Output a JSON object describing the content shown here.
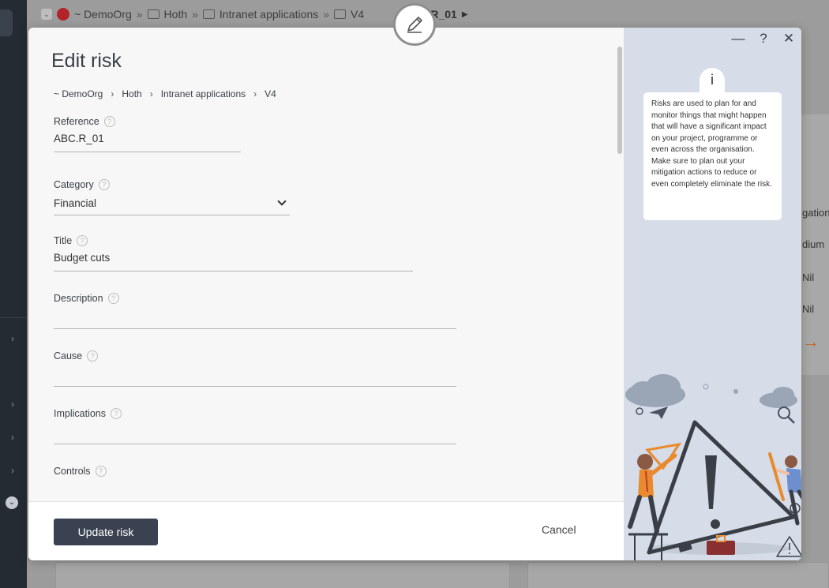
{
  "background": {
    "breadcrumb": [
      "~ DemoOrg",
      "Hoth",
      "Intranet applications",
      "V4",
      "ABC.R_01"
    ],
    "table_cells": [
      "gation",
      "dium",
      "Nil",
      "Nil"
    ]
  },
  "modal": {
    "title": "Edit risk",
    "breadcrumb": [
      "~ DemoOrg",
      "Hoth",
      "Intranet applications",
      "V4"
    ],
    "fields": {
      "reference": {
        "label": "Reference",
        "value": "ABC.R_01"
      },
      "category": {
        "label": "Category",
        "value": "Financial"
      },
      "title": {
        "label": "Title",
        "value": "Budget cuts"
      },
      "description": {
        "label": "Description",
        "value": ""
      },
      "cause": {
        "label": "Cause",
        "value": ""
      },
      "implications": {
        "label": "Implications",
        "value": ""
      },
      "controls": {
        "label": "Controls",
        "value": ""
      }
    },
    "help_glyph": "?",
    "footer": {
      "update_label": "Update risk",
      "cancel_label": "Cancel"
    },
    "window_controls": {
      "minimize": "—",
      "help": "?",
      "close": "✕"
    },
    "info": {
      "icon_glyph": "i",
      "text": "Risks are used to plan for and monitor things that might happen that will have a significant impact on your project, programme or even across the organisation. Make sure to plan out your mitigation actions to reduce or even completely eliminate the risk."
    }
  },
  "colors": {
    "primary_button": "#3a4252",
    "sidebar_panel": "#d6dde8",
    "accent_orange": "#e98a2f"
  }
}
